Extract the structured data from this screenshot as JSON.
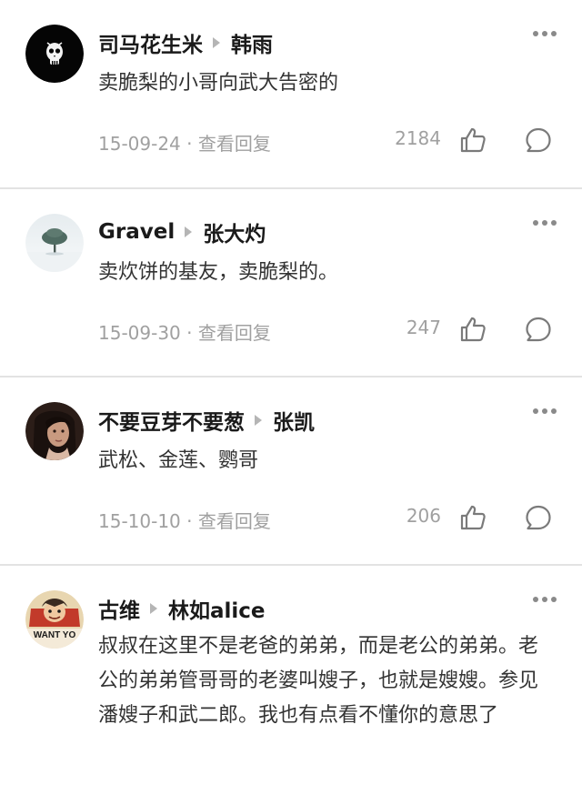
{
  "comments": [
    {
      "username": "司马花生米",
      "reply_to": "韩雨",
      "content": "卖脆梨的小哥向武大告密的",
      "date": "15-09-24",
      "view_replies_label": "查看回复",
      "likes": "2184",
      "avatar_icon": "skull-avatar"
    },
    {
      "username": "Gravel",
      "reply_to": "张大灼",
      "content": "卖炊饼的基友，卖脆梨的。",
      "date": "15-09-30",
      "view_replies_label": "查看回复",
      "likes": "247",
      "avatar_icon": "tree-avatar"
    },
    {
      "username": "不要豆芽不要葱",
      "reply_to": "张凯",
      "content": "武松、金莲、鹦哥",
      "date": "15-10-10",
      "view_replies_label": "查看回复",
      "likes": "206",
      "avatar_icon": "portrait-avatar"
    },
    {
      "username": "古维",
      "reply_to": "林如alice",
      "content": "叔叔在这里不是老爸的弟弟，而是老公的弟弟。老公的弟弟管哥哥的老婆叫嫂子，也就是嫂嫂。参见潘嫂子和武二郎。我也有点看不懂你的意思了",
      "avatar_icon": "cartoon-avatar",
      "avatar_text": "WANT YO"
    }
  ],
  "separator": "·"
}
